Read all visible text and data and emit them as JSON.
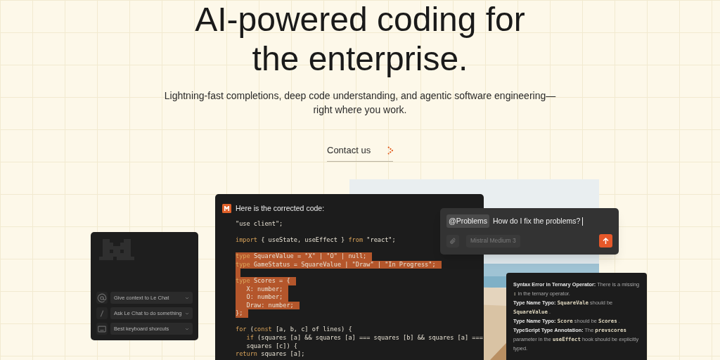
{
  "hero": {
    "title_lines": [
      "AI-powered coding for",
      "the enterprise."
    ],
    "subtitle_lines": [
      "Lightning-fast completions, deep code understanding, and agentic software engineering—",
      "right where you work."
    ],
    "cta": {
      "label": "Contact us"
    }
  },
  "shortcuts_card": {
    "items": [
      {
        "label": "Give context to Le Chat"
      },
      {
        "label": "Ask Le Chat to do something"
      },
      {
        "label": "Best keyboard shorcuts"
      }
    ]
  },
  "code_panel": {
    "heading": "Here is the corrected code:",
    "lines": [
      {
        "highlighted": false,
        "segments": [
          {
            "kind": "plain",
            "text": "\"use client\";"
          }
        ]
      },
      {
        "highlighted": false
      },
      {
        "highlighted": false,
        "segments": [
          {
            "kind": "keyword",
            "text": "import"
          },
          {
            "kind": "plain",
            "text": " { useState, useEffect } "
          },
          {
            "kind": "keyword",
            "text": "from"
          },
          {
            "kind": "plain",
            "text": " \"react\";"
          }
        ]
      },
      {
        "highlighted": false
      },
      {
        "highlighted": true,
        "segments": [
          {
            "kind": "keyword",
            "text": "type"
          },
          {
            "kind": "plain",
            "text": " SquareValue = \"X\" | \"O\" | null;"
          }
        ]
      },
      {
        "highlighted": true,
        "segments": [
          {
            "kind": "keyword",
            "text": "type"
          },
          {
            "kind": "plain",
            "text": " GameStatus = SquareValue | \"Draw\" | \"In Progress\";"
          }
        ]
      },
      {
        "highlighted": true
      },
      {
        "highlighted": true,
        "segments": [
          {
            "kind": "keyword",
            "text": "type"
          },
          {
            "kind": "plain",
            "text": " Scores = {"
          }
        ]
      },
      {
        "highlighted": true,
        "segments": [
          {
            "kind": "plain",
            "text": "   X: number;"
          }
        ]
      },
      {
        "highlighted": true,
        "segments": [
          {
            "kind": "plain",
            "text": "   O: number;"
          }
        ]
      },
      {
        "highlighted": true,
        "segments": [
          {
            "kind": "plain",
            "text": "   Draw: number;"
          }
        ]
      },
      {
        "highlighted": true,
        "segments": [
          {
            "kind": "plain",
            "text": "};"
          }
        ]
      },
      {
        "highlighted": false
      },
      {
        "highlighted": false,
        "segments": [
          {
            "kind": "keyword",
            "text": "for"
          },
          {
            "kind": "plain",
            "text": " ("
          },
          {
            "kind": "keyword",
            "text": "const"
          },
          {
            "kind": "plain",
            "text": " [a, b, c] of lines) {"
          }
        ]
      },
      {
        "highlighted": false,
        "segments": [
          {
            "kind": "keyword",
            "text": "   if"
          },
          {
            "kind": "plain",
            "text": " (squares [a] && squares [a] === squares [b] && squares [a] ==="
          }
        ]
      },
      {
        "highlighted": false,
        "segments": [
          {
            "kind": "plain",
            "text": "   squares [c]) {"
          }
        ]
      },
      {
        "highlighted": false,
        "segments": [
          {
            "kind": "keyword",
            "text": "return"
          },
          {
            "kind": "plain",
            "text": " squares [a];"
          }
        ]
      }
    ]
  },
  "prompt_box": {
    "mention": "@Problems",
    "value": "How do I fix the problems?",
    "model": "Mistral Medium 3"
  },
  "problems_panel": {
    "paragraphs": [
      [
        {
          "kind": "bold",
          "text": "Syntax Error in Ternary Operator:"
        },
        {
          "kind": "text",
          "text": " There is a missing "
        },
        {
          "kind": "code",
          "text": ":"
        },
        {
          "kind": "text",
          "text": " in the ternary operator."
        }
      ],
      [
        {
          "kind": "bold",
          "text": "Type Name Typo: "
        },
        {
          "kind": "code",
          "text": "SquareVale"
        },
        {
          "kind": "text",
          "text": " should be "
        },
        {
          "kind": "code",
          "text": "SquareValue"
        },
        {
          "kind": "text",
          "text": " ."
        }
      ],
      [
        {
          "kind": "bold",
          "text": "Type Name Typo: "
        },
        {
          "kind": "code",
          "text": "Score"
        },
        {
          "kind": "text",
          "text": " should be "
        },
        {
          "kind": "code",
          "text": "Scores"
        },
        {
          "kind": "text",
          "text": " ."
        }
      ],
      [
        {
          "kind": "bold",
          "text": "TypeScript Type Annotation:"
        },
        {
          "kind": "text",
          "text": " The "
        },
        {
          "kind": "code",
          "text": "prevscores"
        },
        {
          "kind": "text",
          "text": " parameter in the "
        },
        {
          "kind": "code",
          "text": "useEffect"
        },
        {
          "kind": "text",
          "text": "  hook should be explicitly typed."
        }
      ]
    ]
  }
}
